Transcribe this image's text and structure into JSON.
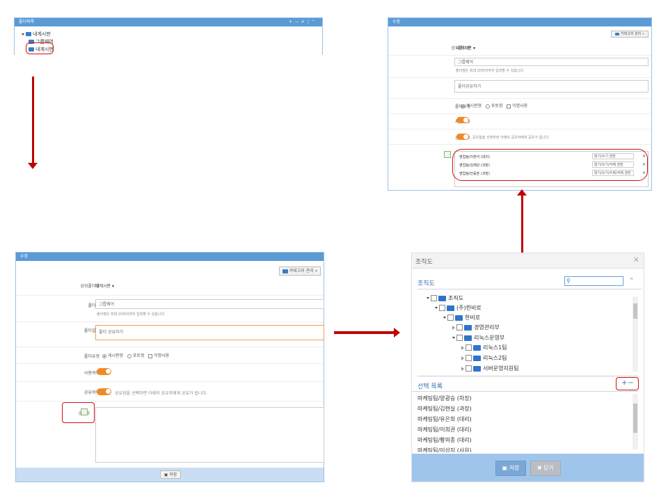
{
  "folder_panel": {
    "title": "폴더목록",
    "toolbar": [
      "+",
      "−",
      "✔",
      "⌃"
    ],
    "tree": [
      {
        "label": "내게시판"
      },
      {
        "label": "그룹웨어"
      },
      {
        "label": "내게시판"
      }
    ]
  },
  "edit_form": {
    "title": "수정",
    "category_button": "카테고리 관리 »",
    "parent_folder_label": "상위폴더명",
    "parent_folder_value": "내게시판",
    "folder_name_label": "폴더명",
    "folder_name_value": "그룹웨어",
    "folder_name_hint": "폴더명은 최대 20자리까지 입력할 수 있습니다.",
    "desc_label": "폴더설명",
    "desc_value_small": "폴더공유하기",
    "desc_value_big": "폴더 공유하기",
    "type_label": "폴더유형",
    "type_options": [
      "게시판형",
      "포토형",
      "익명사용"
    ],
    "use_label": "사용여부",
    "share_label": "공유여부",
    "share_hint": "공유함을 선택하면 아래의 공유자에게 공유가 됩니다.",
    "sharer_label": "공유자",
    "save_button": "저장",
    "sharers": [
      {
        "name": "영업팀/이현석 (대리)",
        "perm": "읽기/쓰기 권한"
      },
      {
        "name": "영업팀/김재원 (과장)",
        "perm": "읽기/쓰기/삭제 권한"
      },
      {
        "name": "영업팀/안동훈 (과장)",
        "perm": "읽기/쓰기/수정/삭제 권한"
      }
    ]
  },
  "org_dialog": {
    "title": "조직도",
    "section_title": "조직도",
    "tree": [
      {
        "label": "조직도"
      },
      {
        "label": "(주)한비로"
      },
      {
        "label": "한비로"
      },
      {
        "label": "경영관리부"
      },
      {
        "label": "리눅스운영부"
      },
      {
        "label": "리눅스1팀"
      },
      {
        "label": "리눅스2팀"
      },
      {
        "label": "서버운영지원팀"
      }
    ],
    "selected_title": "선택 목록",
    "selected": [
      "마케팅팀/양광승 (차장)",
      "마케팅팀/김현실 (과장)",
      "마케팅팀/유은희 (대리)",
      "마케팅팀/이희권 (대리)",
      "마케팅팀/황의종 (대리)",
      "마케팅팀/이상지 (사원)"
    ],
    "save_button": "저장",
    "close_button": "닫기"
  },
  "colors": {
    "header": "#5b9bd5",
    "annotation": "#d01010",
    "toggle": "#f08a24",
    "footer": "#9fc6ea"
  }
}
